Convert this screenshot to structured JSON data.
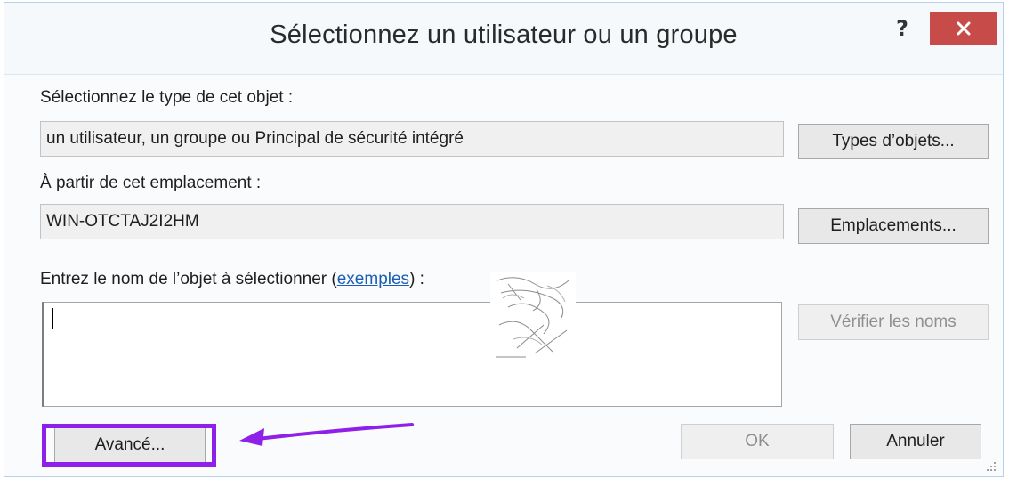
{
  "dialog": {
    "title": "Sélectionnez un utilisateur ou un groupe",
    "help_label": "?",
    "close_icon": "close-icon"
  },
  "object_type": {
    "label": "Sélectionnez le type de cet objet :",
    "value": "un utilisateur, un groupe ou Principal de sécurité intégré",
    "button_label": "Types d’objets..."
  },
  "location": {
    "label": "À partir de cet emplacement :",
    "value": "WIN-OTCTAJ2I2HM",
    "button_label": "Emplacements..."
  },
  "object_name": {
    "label_prefix": "Entrez le nom de l’objet à sélectionner (",
    "link_text": "exemples",
    "label_suffix": ") :",
    "value": "",
    "check_button_label": "Vérifier les noms"
  },
  "footer": {
    "advanced_label": "Avancé...",
    "ok_label": "OK",
    "cancel_label": "Annuler"
  },
  "colors": {
    "highlight": "#8f20e9",
    "close_button": "#c74b49",
    "link": "#1a5fb4"
  }
}
